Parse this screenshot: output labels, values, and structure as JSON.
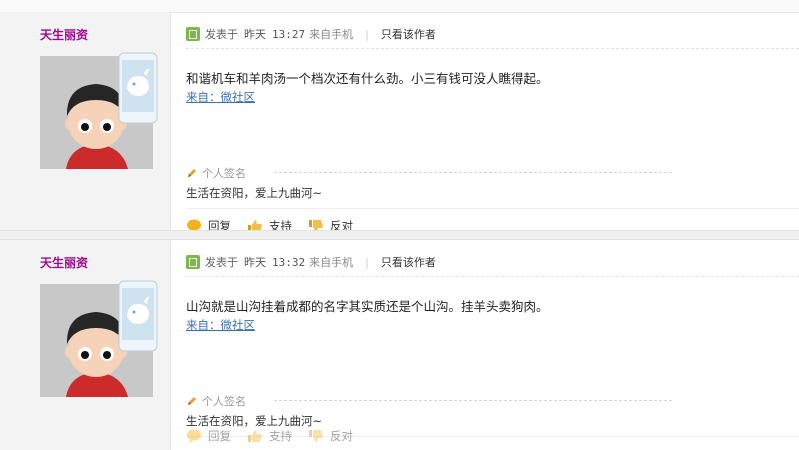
{
  "posts": [
    {
      "username": "天生丽资",
      "posted_label": "发表于",
      "posted_day": "昨天",
      "posted_time": "13:27",
      "posted_from": "来自手机",
      "author_only": "只看该作者",
      "body": "和谐机车和羊肉汤一个档次还有什么劲。小三有钱可没人瞧得起。",
      "source": "来自：微社区",
      "signature_label": "个人签名",
      "signature": "生活在资阳，爱上九曲河~",
      "actions": [
        "回复",
        "支持",
        "反对"
      ]
    },
    {
      "username": "天生丽资",
      "posted_label": "发表于",
      "posted_day": "昨天",
      "posted_time": "13:32",
      "posted_from": "来自手机",
      "author_only": "只看该作者",
      "body": "山沟就是山沟挂着成都的名字其实质还是个山沟。挂羊头卖狗肉。",
      "source": "来自：微社区",
      "signature_label": "个人签名",
      "signature": "生活在资阳，爱上九曲河~",
      "actions": [
        "回复",
        "支持",
        "反对"
      ]
    }
  ],
  "colors": {
    "username": "#a1078f",
    "link": "#3d6fb4",
    "badge": "#7cb84a"
  }
}
